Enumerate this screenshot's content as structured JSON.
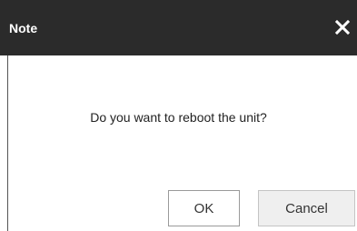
{
  "dialog": {
    "title": "Note",
    "close_icon": "close-icon",
    "message": "Do you want to reboot the unit?",
    "ok_label": "OK",
    "cancel_label": "Cancel"
  },
  "colors": {
    "titlebar_bg": "#2b2b2b",
    "titlebar_text": "#ffffff",
    "cancel_bg": "#efefef"
  }
}
